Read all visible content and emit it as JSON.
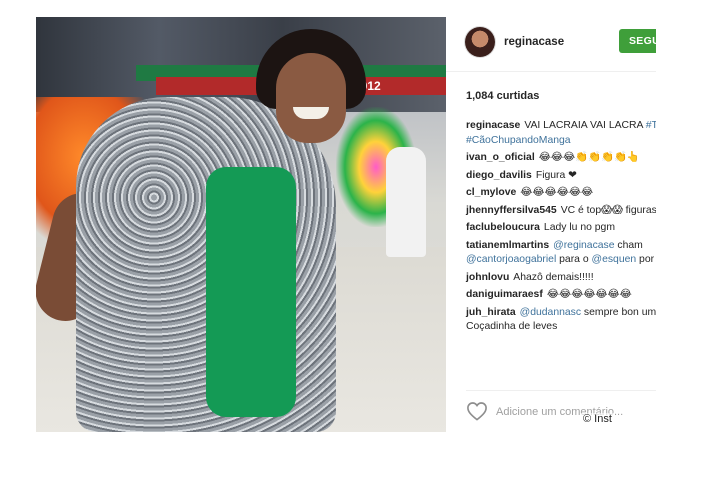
{
  "post": {
    "username": "reginacase",
    "follow_label": "SEGU",
    "likes": "1,084 curtidas",
    "comments": [
      {
        "user": "reginacase",
        "parts": [
          {
            "t": "VAI LACRAIA VAI LACRA"
          },
          {
            "t": " #ToZoada #CãoChupandoManga",
            "k": "tag"
          }
        ]
      },
      {
        "user": "ivan_o_oficial",
        "parts": [
          {
            "t": "😂😂😂👏👏👏👏👆"
          }
        ]
      },
      {
        "user": "diego_davilis",
        "parts": [
          {
            "t": "Figura ❤"
          }
        ]
      },
      {
        "user": "cl_mylove",
        "parts": [
          {
            "t": "😂😂😂😂😂😂"
          }
        ]
      },
      {
        "user": "jhennyffersilva545",
        "parts": [
          {
            "t": "VC é top😱😱 figurassa"
          }
        ]
      },
      {
        "user": "faclubeloucura",
        "parts": [
          {
            "t": "Lady lu no pgm"
          }
        ]
      },
      {
        "user": "tatianemlmartins",
        "parts": [
          {
            "t": "@reginacase",
            "k": "mention"
          },
          {
            "t": " cham "
          },
          {
            "t": "@cantorjoaogabriel",
            "k": "mention"
          },
          {
            "t": " para o "
          },
          {
            "t": "@esquen",
            "k": "mention"
          },
          {
            "t": " por favor"
          }
        ]
      },
      {
        "user": "johnlovu",
        "parts": [
          {
            "t": "Ahazô demais!!!!!"
          }
        ]
      },
      {
        "user": "daniguimaraesf",
        "parts": [
          {
            "t": "😂😂😂😂😂😂😂"
          }
        ]
      },
      {
        "user": "juh_hirata",
        "parts": [
          {
            "t": "@dudannasc",
            "k": "mention"
          },
          {
            "t": " sempre bon umas Coçadinha de leves"
          }
        ]
      }
    ],
    "add_comment_placeholder": "Adicione um comentário...",
    "photo_sign": "2012",
    "watermark": "© Inst"
  },
  "colors": {
    "follow": "#3f9f3a",
    "link": "#3f729b"
  },
  "icons": {
    "like": "heart-icon"
  }
}
